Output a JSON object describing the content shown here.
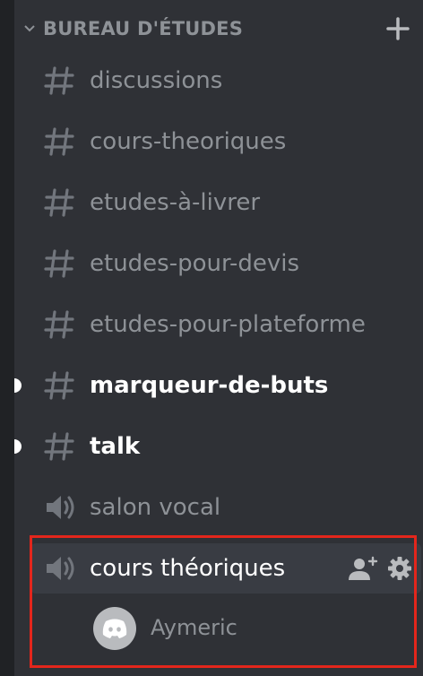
{
  "category": {
    "title": "BUREAU D'ÉTUDES",
    "chevron_icon": "chevron-down-icon",
    "add_icon": "plus-icon"
  },
  "channels": [
    {
      "type": "text",
      "name": "discussions",
      "unread": false,
      "icon": "hashtag-icon"
    },
    {
      "type": "text",
      "name": "cours-theoriques",
      "unread": false,
      "icon": "hashtag-icon"
    },
    {
      "type": "text",
      "name": "etudes-à-livrer",
      "unread": false,
      "icon": "hashtag-icon"
    },
    {
      "type": "text",
      "name": "etudes-pour-devis",
      "unread": false,
      "icon": "hashtag-icon"
    },
    {
      "type": "text",
      "name": "etudes-pour-plateforme",
      "unread": false,
      "icon": "hashtag-icon"
    },
    {
      "type": "text",
      "name": "marqueur-de-buts",
      "unread": true,
      "icon": "hashtag-icon"
    },
    {
      "type": "text",
      "name": "talk",
      "unread": true,
      "icon": "hashtag-icon"
    },
    {
      "type": "voice",
      "name": "salon vocal",
      "unread": false,
      "icon": "speaker-icon"
    },
    {
      "type": "voice",
      "name": "cours théoriques",
      "unread": false,
      "active": true,
      "icon": "speaker-icon",
      "actions": [
        "invite-user-icon",
        "gear-icon"
      ]
    }
  ],
  "voice_users": [
    {
      "name": "Aymeric",
      "avatar": "discord-logo-icon"
    }
  ],
  "colors": {
    "background": "#2f3136",
    "muted_text": "#8e9297",
    "highlight": "#e3261c",
    "active_bg": "#393c43"
  }
}
